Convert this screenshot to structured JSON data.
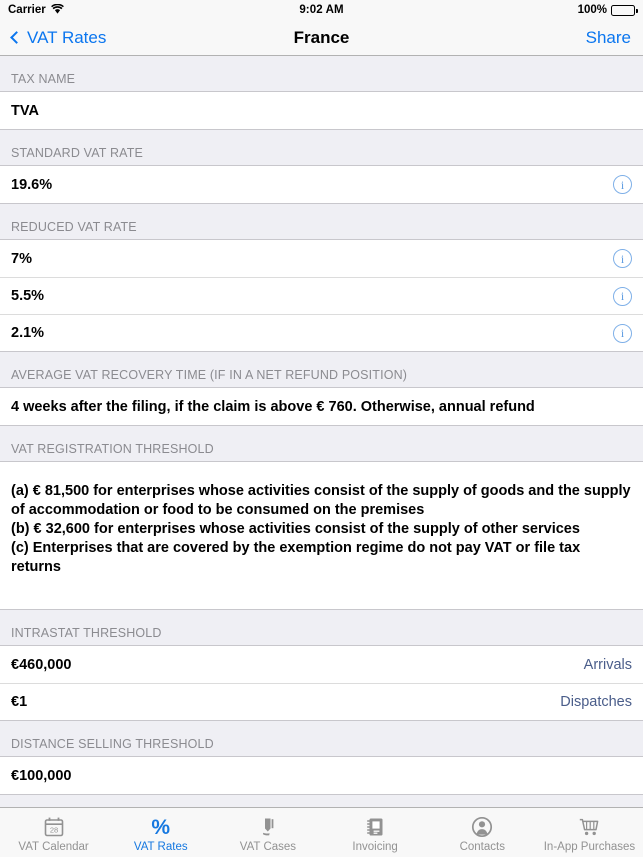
{
  "status_bar": {
    "carrier": "Carrier",
    "wifi_icon": "wifi-icon",
    "time": "9:02 AM",
    "battery_pct": "100%",
    "battery_icon": "battery-icon"
  },
  "nav_bar": {
    "back_label": "VAT Rates",
    "back_icon": "chevron-left-icon",
    "title": "France",
    "action_label": "Share"
  },
  "colors": {
    "accent_blue": "#0b76ef",
    "tab_active_blue": "#1678e0",
    "accessory_blue": "#4a5d8a",
    "info_icon_blue": "#5b9ae0",
    "group_background": "#efeff4",
    "cell_background": "#ffffff",
    "header_text": "#8b8b90"
  },
  "sections": [
    {
      "header": "TAX NAME",
      "rows": [
        {
          "value": "TVA",
          "accessory": null,
          "info_icon": false
        }
      ]
    },
    {
      "header": "STANDARD VAT RATE",
      "rows": [
        {
          "value": "19.6%",
          "accessory": null,
          "info_icon": true,
          "info_icon_name": "info-icon"
        }
      ]
    },
    {
      "header": "REDUCED VAT RATE",
      "rows": [
        {
          "value": "7%",
          "accessory": null,
          "info_icon": true,
          "info_icon_name": "info-icon"
        },
        {
          "value": "5.5%",
          "accessory": null,
          "info_icon": true,
          "info_icon_name": "info-icon"
        },
        {
          "value": "2.1%",
          "accessory": null,
          "info_icon": true,
          "info_icon_name": "info-icon"
        }
      ]
    },
    {
      "header": "AVERAGE VAT RECOVERY TIME (IF IN A NET REFUND POSITION)",
      "rows": [
        {
          "value": "4 weeks after the filing, if the claim is above € 760. Otherwise, annual refund",
          "accessory": null,
          "info_icon": false
        }
      ]
    },
    {
      "header": "VAT REGISTRATION THRESHOLD",
      "block_lines": [
        "(a) € 81,500 for enterprises whose activities consist of the supply of goods and the supply of accommodation or food to be consumed on the premises",
        "(b) € 32,600 for enterprises whose activities consist of the supply of other services",
        "(c) Enterprises that are covered by the exemption regime do not pay VAT or file tax returns"
      ]
    },
    {
      "header": "INTRASTAT THRESHOLD",
      "rows": [
        {
          "value": "€460,000",
          "accessory": "Arrivals",
          "info_icon": false
        },
        {
          "value": "€1",
          "accessory": "Dispatches",
          "info_icon": false
        }
      ]
    },
    {
      "header": "DISTANCE SELLING THRESHOLD",
      "rows": [
        {
          "value": "€100,000",
          "accessory": null,
          "info_icon": false
        }
      ]
    }
  ],
  "tab_bar": {
    "items": [
      {
        "label": "VAT Calendar",
        "icon": "calendar-icon",
        "icon_badge": "28",
        "active": false
      },
      {
        "label": "VAT Rates",
        "icon": "percent-icon",
        "glyph": "%",
        "active": true
      },
      {
        "label": "VAT Cases",
        "icon": "gavel-icon",
        "active": false
      },
      {
        "label": "Invoicing",
        "icon": "notebook-icon",
        "active": false
      },
      {
        "label": "Contacts",
        "icon": "person-circle-icon",
        "active": false
      },
      {
        "label": "In-App Purchases",
        "icon": "shopping-cart-icon",
        "active": false
      }
    ]
  }
}
